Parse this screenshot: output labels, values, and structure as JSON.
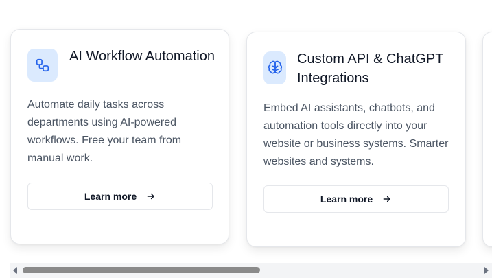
{
  "cards": [
    {
      "title": "AI Workflow Automation",
      "description": "Automate daily tasks across departments using AI-powered workflows. Free your team from manual work.",
      "button_label": "Learn more",
      "icon": "workflow-icon"
    },
    {
      "title": "Custom API & ChatGPT Integrations",
      "description": "Embed AI assistants, chatbots, and automation tools directly into your website or business systems. Smarter websites and systems.",
      "button_label": "Learn more",
      "icon": "brain-icon"
    }
  ],
  "colors": {
    "accent": "#2563eb",
    "icon_bg": "#dbeafe",
    "text": "#111827",
    "muted_text": "#4b5563"
  }
}
